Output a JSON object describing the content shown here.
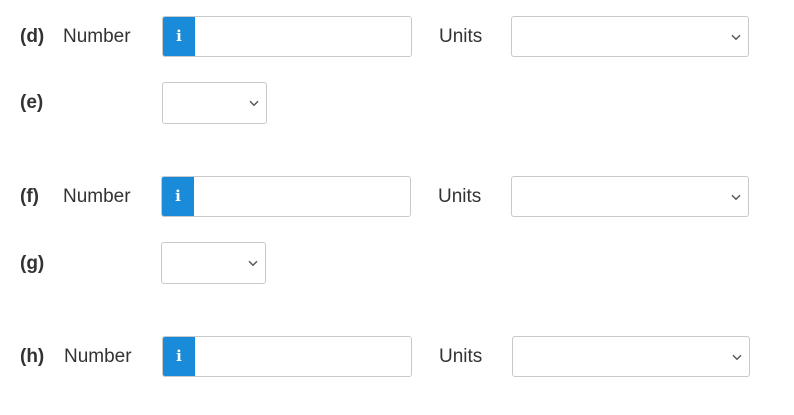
{
  "parts": [
    {
      "id": "d",
      "label": "(d)",
      "kind": "number-units",
      "number_label": "Number",
      "info_icon": "i",
      "number_value": "",
      "units_label": "Units",
      "units_selected": ""
    },
    {
      "id": "e",
      "label": "(e)",
      "kind": "select",
      "selected": ""
    },
    {
      "id": "f",
      "label": "(f)",
      "kind": "number-units",
      "number_label": "Number",
      "info_icon": "i",
      "number_value": "",
      "units_label": "Units",
      "units_selected": ""
    },
    {
      "id": "g",
      "label": "(g)",
      "kind": "select",
      "selected": ""
    },
    {
      "id": "h",
      "label": "(h)",
      "kind": "number-units",
      "number_label": "Number",
      "info_icon": "i",
      "number_value": "",
      "units_label": "Units",
      "units_selected": ""
    }
  ],
  "icons": {
    "info": "info-icon",
    "dropdown": "chevron-down-icon"
  },
  "colors": {
    "info_button": "#1a8bd8",
    "border": "#c9c9c9",
    "text": "#333333"
  }
}
